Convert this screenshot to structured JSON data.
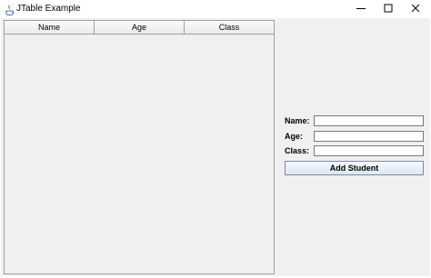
{
  "window": {
    "title": "JTable Example",
    "controls": [
      "minimize-icon",
      "maximize-icon",
      "close-icon"
    ]
  },
  "table": {
    "columns": [
      "Name",
      "Age",
      "Class"
    ],
    "rows": []
  },
  "form": {
    "name_label": "Name:",
    "age_label": "Age:",
    "class_label": "Class:",
    "name_value": "",
    "age_value": "",
    "class_value": "",
    "add_button_label": "Add Student"
  },
  "colors": {
    "background": "#f0f0f0",
    "border": "#a0a0a0"
  }
}
